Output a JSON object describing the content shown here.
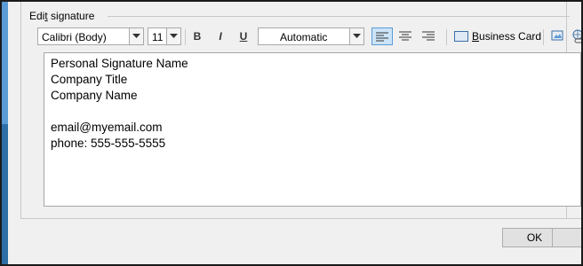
{
  "group": {
    "title": "Edit signature",
    "title_mnemonic": "t"
  },
  "toolbar": {
    "font_name": "Calibri (Body)",
    "font_size": "11",
    "bold_label": "B",
    "italic_label": "I",
    "underline_label": "U",
    "font_color": "Automatic",
    "business_card_label": "Business Card",
    "align_left_active": true
  },
  "editor": {
    "lines": [
      "Personal Signature Name",
      "Company Title",
      "Company Name",
      "",
      "email@myemail.com",
      "phone: 555-555-5555"
    ]
  },
  "buttons": {
    "ok_label": "OK"
  },
  "colors": {
    "accent": "#5b9bd5",
    "active_button": "#cce4f7",
    "dialog_bg": "#f0f0f0"
  }
}
